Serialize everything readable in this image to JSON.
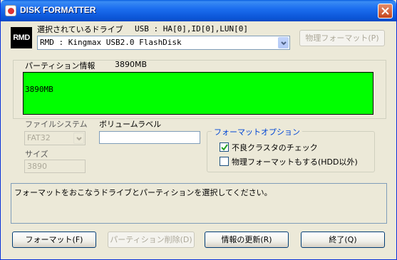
{
  "window": {
    "title": "DISK FORMATTER",
    "title_icon": "disk-formatter-app-icon",
    "close_icon": "close-icon",
    "titlebar_color": "#0b55d6"
  },
  "logo": {
    "text": "RMD"
  },
  "drive": {
    "label": "選択されているドライブ",
    "address": "USB : HA[0],ID[0],LUN[0]",
    "selected": "RMD : Kingmax USB2.0 FlashDisk"
  },
  "physical_format_button": "物理フォーマット(P)",
  "partition": {
    "label": "パーティション情報",
    "total": "3890MB",
    "bar_label": "3890MB",
    "bar_color": "#00ff00"
  },
  "filesystem": {
    "label": "ファイルシステム",
    "value": "FAT32"
  },
  "volume_label": {
    "label": "ボリュームラベル",
    "value": ""
  },
  "size": {
    "label": "サイズ",
    "value": "3890"
  },
  "format_options": {
    "title": "フォーマットオプション",
    "check_bad_cluster": {
      "label": "不良クラスタのチェック",
      "checked": true
    },
    "physical_format": {
      "label": "物理フォーマットもする(HDD以外)",
      "checked": false
    }
  },
  "status_message": "フォーマットをおこなうドライブとパーティションを選択してください。",
  "buttons": {
    "format": "フォーマット(F)",
    "delete_partition": "パーティション削除(D)",
    "refresh": "情報の更新(R)",
    "exit": "終了(Q)"
  }
}
